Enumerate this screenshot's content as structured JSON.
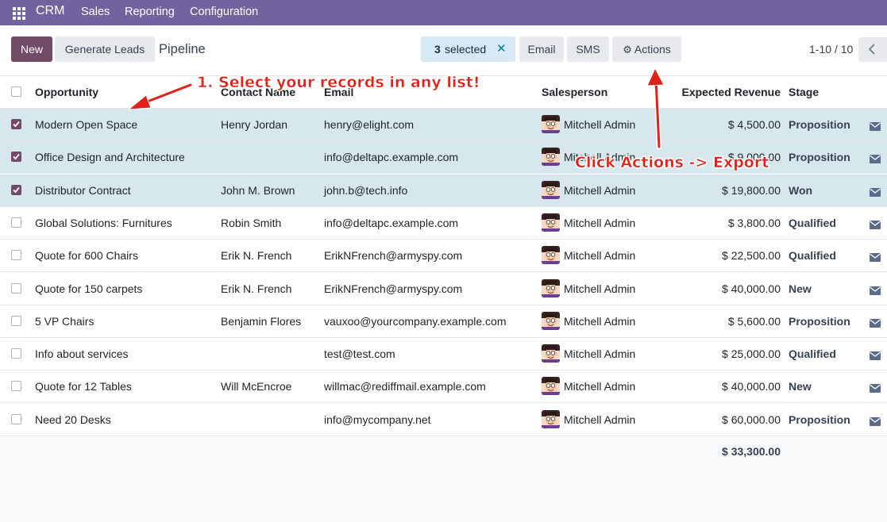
{
  "nav": {
    "brand": "CRM",
    "items": [
      "Sales",
      "Reporting",
      "Configuration"
    ]
  },
  "control": {
    "new_label": "New",
    "generate_label": "Generate Leads",
    "breadcrumb": "Pipeline",
    "selected_count": "3",
    "selected_text": "selected",
    "email_label": "Email",
    "sms_label": "SMS",
    "actions_label": "Actions",
    "pager": "1-10 / 10"
  },
  "table": {
    "headers": {
      "opportunity": "Opportunity",
      "contact": "Contact Name",
      "email": "Email",
      "salesperson": "Salesperson",
      "revenue": "Expected Revenue",
      "stage": "Stage"
    },
    "rows": [
      {
        "selected": true,
        "opportunity": "Modern Open Space",
        "contact": "Henry Jordan",
        "email": "henry@elight.com",
        "salesperson": "Mitchell Admin",
        "revenue": "$ 4,500.00",
        "stage": "Proposition"
      },
      {
        "selected": true,
        "opportunity": "Office Design and Architecture",
        "contact": "",
        "email": "info@deltapc.example.com",
        "salesperson": "Mitchell Admin",
        "revenue": "$ 9,000.00",
        "stage": "Proposition"
      },
      {
        "selected": true,
        "opportunity": "Distributor Contract",
        "contact": "John M. Brown",
        "email": "john.b@tech.info",
        "salesperson": "Mitchell Admin",
        "revenue": "$ 19,800.00",
        "stage": "Won"
      },
      {
        "selected": false,
        "opportunity": "Global Solutions: Furnitures",
        "contact": "Robin Smith",
        "email": "info@deltapc.example.com",
        "salesperson": "Mitchell Admin",
        "revenue": "$ 3,800.00",
        "stage": "Qualified"
      },
      {
        "selected": false,
        "opportunity": "Quote for 600 Chairs",
        "contact": "Erik N. French",
        "email": "ErikNFrench@armyspy.com",
        "salesperson": "Mitchell Admin",
        "revenue": "$ 22,500.00",
        "stage": "Qualified"
      },
      {
        "selected": false,
        "opportunity": "Quote for 150 carpets",
        "contact": "Erik N. French",
        "email": "ErikNFrench@armyspy.com",
        "salesperson": "Mitchell Admin",
        "revenue": "$ 40,000.00",
        "stage": "New"
      },
      {
        "selected": false,
        "opportunity": "5 VP Chairs",
        "contact": "Benjamin Flores",
        "email": "vauxoo@yourcompany.example.com",
        "salesperson": "Mitchell Admin",
        "revenue": "$ 5,600.00",
        "stage": "Proposition"
      },
      {
        "selected": false,
        "opportunity": "Info about services",
        "contact": "",
        "email": "test@test.com",
        "salesperson": "Mitchell Admin",
        "revenue": "$ 25,000.00",
        "stage": "Qualified"
      },
      {
        "selected": false,
        "opportunity": "Quote for 12 Tables",
        "contact": "Will McEncroe",
        "email": "willmac@rediffmail.example.com",
        "salesperson": "Mitchell Admin",
        "revenue": "$ 40,000.00",
        "stage": "New"
      },
      {
        "selected": false,
        "opportunity": "Need 20 Desks",
        "contact": "",
        "email": "info@mycompany.net",
        "salesperson": "Mitchell Admin",
        "revenue": "$ 60,000.00",
        "stage": "Proposition"
      }
    ],
    "total": "$ 33,300.00"
  },
  "annotations": {
    "step1": "1. Select your records in any list!",
    "step2": "Click Actions -> Export"
  },
  "colors": {
    "navbar": "#71639e",
    "primary": "#714b67",
    "selected_row": "#d6e8ee",
    "annotation": "#e0221a"
  }
}
